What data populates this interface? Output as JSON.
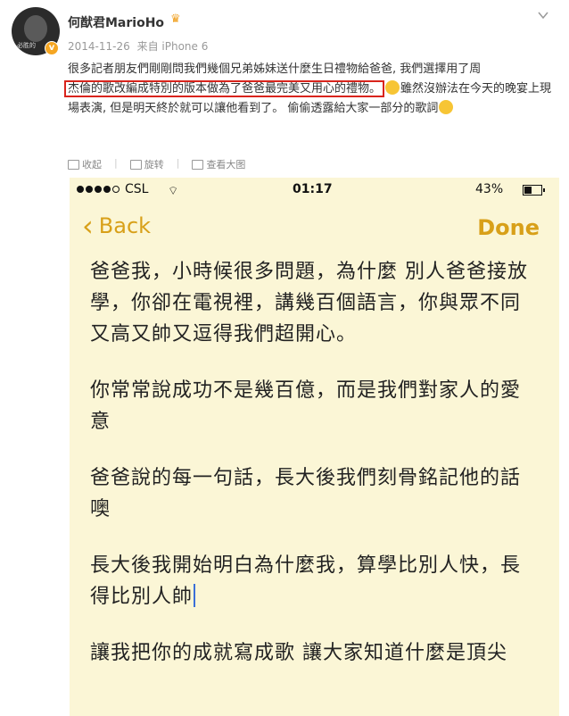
{
  "post": {
    "author": "何猷君MarioHo",
    "avatar_mark": "必胜的",
    "date": "2014-11-26",
    "source": "来自 iPhone 6",
    "text_before": "很多記者朋友們剛剛問我們幾個兄弟姊妹送什麼生日禮物給爸爸, 我們選擇用了周",
    "text_highlight": "杰倫的歌改編成特別的版本做為了爸爸最完美又用心的禮物。",
    "text_after": "雖然沒辦法在今天的晚宴上現場表演, 但是明天終於就可以讓他看到了。 偷偷透露給大家一部分的歌詞",
    "actions": [
      "收起",
      "旋转",
      "查看大图"
    ]
  },
  "phone": {
    "carrier": "CSL",
    "time": "01:17",
    "battery": "43%",
    "battery_level": 0.43,
    "back_label": "Back",
    "done_label": "Done",
    "lyrics": [
      "爸爸我，小時候很多問題，為什麼 別人爸爸接放學，你卻在電視裡，講幾百個語言，你與眾不同又高又帥又逗得我們超開心。",
      "你常常說成功不是幾百億，而是我們對家人的愛意",
      "爸爸說的每一句話，長大後我們刻骨銘記他的話 噢",
      "長大後我開始明白為什麼我，算學比別人快，長得比別人帥",
      "讓我把你的成就寫成歌 讓大家知道什麼是頂尖"
    ]
  },
  "colors": {
    "highlight_border": "#d9241c",
    "ios_accent": "#d8a019",
    "notes_bg": "#fbf6d6",
    "cursor": "#3b6fd8"
  },
  "icons": [
    "chevron-down-icon",
    "crown-icon",
    "verified-badge-icon",
    "collapse-icon",
    "rotate-icon",
    "view-large-icon",
    "wifi-icon",
    "battery-icon",
    "back-chevron-icon"
  ]
}
